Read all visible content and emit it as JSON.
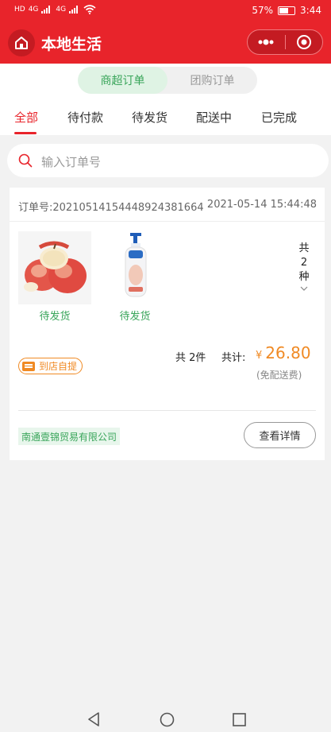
{
  "status_bar": {
    "left_text": "HD",
    "signal_1": "4G",
    "signal_2": "4G",
    "battery_percent": "57%",
    "time": "3:44",
    "battery_level": 0.57
  },
  "nav": {
    "title": "本地生活",
    "home_icon": "home-icon",
    "more_icon": "more-dots-icon",
    "close_icon": "target-close-icon"
  },
  "segments": [
    {
      "label": "商超订单",
      "active": true
    },
    {
      "label": "团购订单",
      "active": false
    }
  ],
  "tabs": [
    {
      "label": "全部",
      "active": true
    },
    {
      "label": "待付款",
      "active": false
    },
    {
      "label": "待发货",
      "active": false
    },
    {
      "label": "配送中",
      "active": false
    },
    {
      "label": "已完成",
      "active": false
    }
  ],
  "search": {
    "placeholder": "输入订单号",
    "icon": "search-icon"
  },
  "order": {
    "order_no": "订单号:20210514154448924381664",
    "time": "2021-05-14 15:44:48",
    "products": [
      {
        "image": "apple-image",
        "status": "待发货"
      },
      {
        "image": "body-wash-bottle-image",
        "status": "待发货"
      }
    ],
    "kinds": {
      "line1": "共",
      "line2": "2",
      "line3": "种"
    },
    "pickup_label": "到店自提",
    "quantity": "共 2件",
    "total_label": "共计:",
    "currency": "¥",
    "total": "26.80",
    "delivery_note": "(免配送费)",
    "store": "南通壹锦贸易有限公司",
    "detail_button": "查看详情"
  },
  "colors": {
    "brand_red": "#e8242b",
    "green": "#39a55a",
    "orange": "#f08a24"
  }
}
